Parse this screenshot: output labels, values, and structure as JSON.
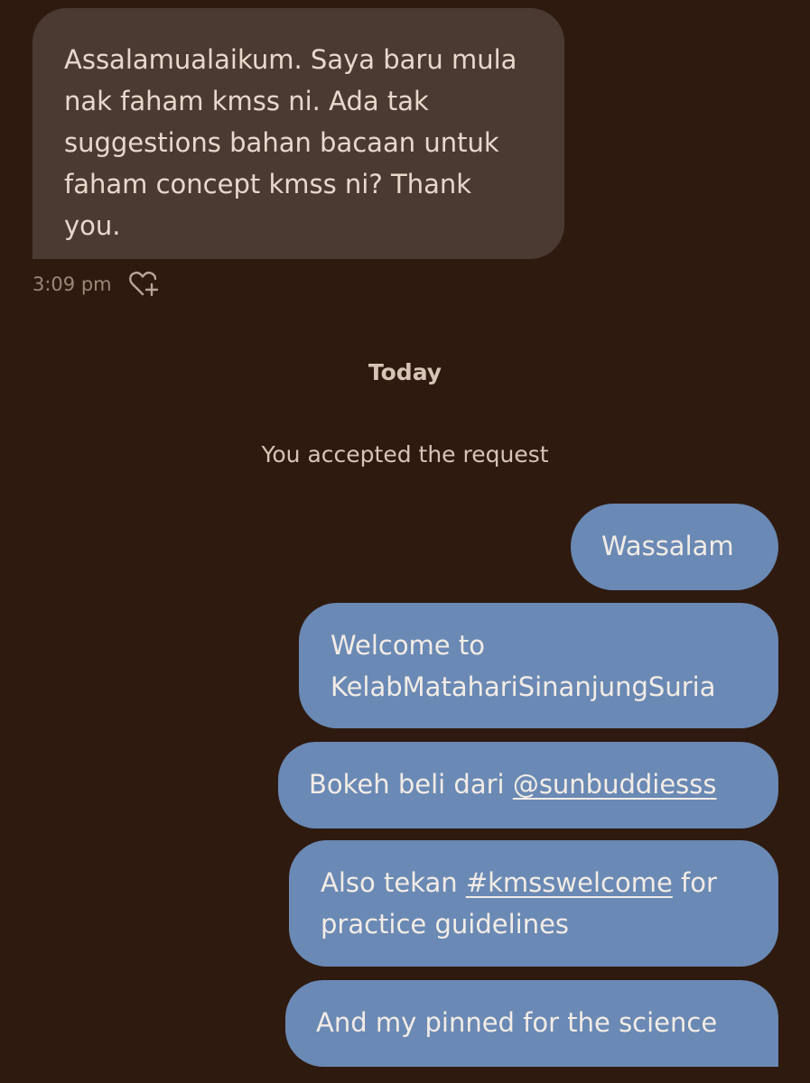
{
  "incoming": {
    "text": "Assalamualaikum. Saya baru mula nak faham kmss ni. Ada tak suggestions bahan bacaan untuk faham concept kmss ni? Thank you.",
    "timestamp": "3:09 pm",
    "react_icon": "heart-plus-icon"
  },
  "separator": {
    "day_label": "Today",
    "system_note": "You accepted the request"
  },
  "outgoing": [
    {
      "text": "Wassalam"
    },
    {
      "text": "Welcome to KelabMatahariSinanjungSuria"
    },
    {
      "prefix": "Bokeh beli dari ",
      "mention": "@sunbuddiesss"
    },
    {
      "prefix": "Also tekan ",
      "hashtag": "#kmsswelcome",
      "suffix": " for practice guidelines"
    },
    {
      "text": "And my pinned for the science"
    }
  ],
  "colors": {
    "background": "#2f1a10",
    "incoming_bubble": "#4b3a31",
    "outgoing_bubble": "#6a89b4",
    "text_light": "#e8d8cc",
    "muted": "#9c8779"
  }
}
